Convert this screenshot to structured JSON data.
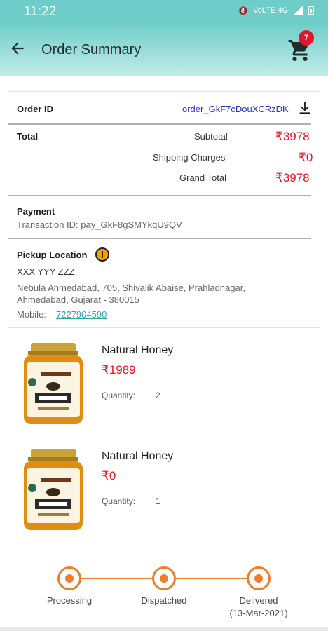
{
  "status_bar": {
    "time": "11:22",
    "network": "VoLTE 4G"
  },
  "app_bar": {
    "title": "Order Summary",
    "cart_count": "7"
  },
  "order": {
    "order_id_label": "Order ID",
    "order_id_value": "order_GkF7cDouXCRzDK",
    "total_label": "Total",
    "subtotal_label": "Subtotal",
    "subtotal_value": "₹3978",
    "shipping_label": "Shipping Charges",
    "shipping_value": "₹0",
    "grand_total_label": "Grand Total",
    "grand_total_value": "₹3978"
  },
  "payment": {
    "label": "Payment",
    "transaction": "Transaction ID: pay_GkF8gSMYkqU9QV"
  },
  "pickup": {
    "label": "Pickup Location",
    "name": "XXX YYY ZZZ",
    "address_line1": "Nebula Ahmedabad, 705, Shivalik Abaise, Prahladnagar,",
    "address_line2": "Ahmedabad, Gujarat - 380015",
    "mobile_label": "Mobile:",
    "mobile_value": "7227904590"
  },
  "items": [
    {
      "name": "Natural Honey",
      "price": "₹1989",
      "quantity_label": "Quantity:",
      "quantity": "2"
    },
    {
      "name": "Natural Honey",
      "price": "₹0",
      "quantity_label": "Quantity:",
      "quantity": "1"
    }
  ],
  "tracking": {
    "steps": [
      {
        "label": "Processing",
        "date": ""
      },
      {
        "label": "Dispatched",
        "date": ""
      },
      {
        "label": "Delivered",
        "date": "(13-Mar-2021)"
      }
    ],
    "accent_color": "#f07d2a"
  },
  "colors": {
    "header": "#6ecdc9",
    "price": "#e8141e",
    "link": "#2ba9a3"
  }
}
